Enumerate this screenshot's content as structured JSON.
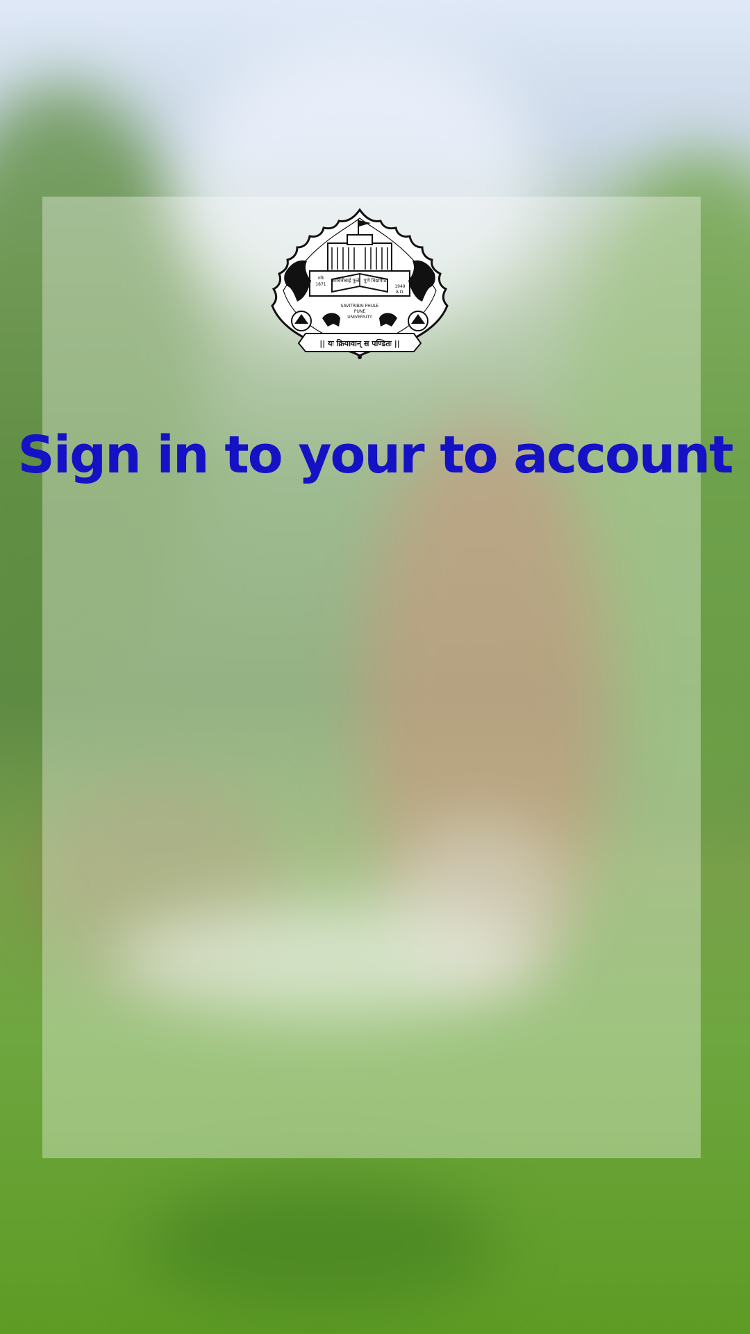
{
  "background": {
    "description_tag": "blurred-campus-background"
  },
  "logo": {
    "icon": "university-seal-icon",
    "text_top_left": "शके 1871",
    "text_top_right": "1949 A.D.",
    "text_book": "सावित्रीबाई फुले पुणे विद्यापीठ",
    "text_center": "SAVITRIBAI PHULE PUNE UNIVERSITY",
    "motto": "|| यः क्रियावान् स पण्डितः ||"
  },
  "title": "Sign in to your to account",
  "colors": {
    "title": "#1511c4",
    "panel": "rgba(255,255,255,0.34)"
  }
}
